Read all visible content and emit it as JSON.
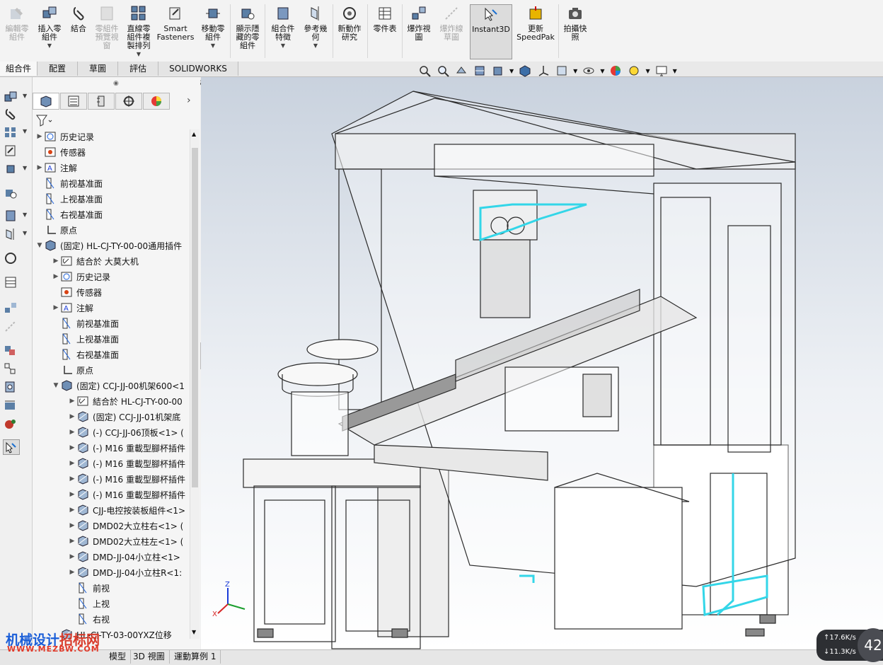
{
  "ribbon": {
    "buttons": [
      {
        "label": "編輯零\n組件",
        "icon": "edit-component-icon",
        "disabled": true
      },
      {
        "label": "插入零\n組件",
        "icon": "insert-component-icon",
        "caret": true
      },
      {
        "label": "結合",
        "icon": "mate-icon"
      },
      {
        "label": "零組件\n預覽視\n窗",
        "icon": "component-preview-icon",
        "disabled": true
      },
      {
        "label": "直線零\n組件複\n製排列",
        "icon": "linear-pattern-icon",
        "caret": true
      },
      {
        "label": "Smart\nFasteners",
        "icon": "smart-fasteners-icon"
      },
      {
        "label": "移動零\n組件",
        "icon": "move-component-icon",
        "caret": true
      },
      {
        "label": "顯示隱\n藏的零\n組件",
        "icon": "show-hidden-icon"
      },
      {
        "label": "組合件\n特徵",
        "icon": "assembly-features-icon",
        "caret": true
      },
      {
        "label": "參考幾\n何",
        "icon": "reference-geometry-icon",
        "caret": true
      },
      {
        "label": "新動作\n研究",
        "icon": "motion-study-icon"
      },
      {
        "label": "零件表",
        "icon": "bom-icon"
      },
      {
        "label": "爆炸視\n圖",
        "icon": "exploded-view-icon"
      },
      {
        "label": "爆炸線\n草圖",
        "icon": "explode-line-icon",
        "disabled": true
      },
      {
        "label": "Instant3D",
        "icon": "instant3d-icon",
        "active": true
      },
      {
        "label": "更新\nSpeedPak",
        "icon": "speedpak-icon"
      },
      {
        "label": "拍攝快\n照",
        "icon": "snapshot-icon"
      }
    ]
  },
  "command_tabs": [
    "組合件",
    "配置",
    "草圖",
    "評估",
    "SOLIDWORKS MBD"
  ],
  "feature_tree": {
    "rows": [
      {
        "level": 0,
        "exp": "▶",
        "icon": "history",
        "label": "历史记录"
      },
      {
        "level": 0,
        "exp": "",
        "icon": "sensor",
        "label": "传感器"
      },
      {
        "level": 0,
        "exp": "▶",
        "icon": "annotation",
        "label": "注解"
      },
      {
        "level": 0,
        "exp": "",
        "icon": "plane",
        "label": "前视基准面"
      },
      {
        "level": 0,
        "exp": "",
        "icon": "plane",
        "label": "上视基准面"
      },
      {
        "level": 0,
        "exp": "",
        "icon": "plane",
        "label": "右视基准面"
      },
      {
        "level": 0,
        "exp": "",
        "icon": "origin",
        "label": "原点"
      },
      {
        "level": 0,
        "exp": "▼",
        "icon": "assembly",
        "label": "(固定) HL-CJ-TY-00-00通用插件"
      },
      {
        "level": 1,
        "exp": "▶",
        "icon": "mates",
        "label": "結合於 大莫大机"
      },
      {
        "level": 1,
        "exp": "▶",
        "icon": "history",
        "label": "历史记录"
      },
      {
        "level": 1,
        "exp": "",
        "icon": "sensor",
        "label": "传感器"
      },
      {
        "level": 1,
        "exp": "▶",
        "icon": "annotation",
        "label": "注解"
      },
      {
        "level": 1,
        "exp": "",
        "icon": "plane",
        "label": "前视基准面"
      },
      {
        "level": 1,
        "exp": "",
        "icon": "plane",
        "label": "上视基准面"
      },
      {
        "level": 1,
        "exp": "",
        "icon": "plane",
        "label": "右视基准面"
      },
      {
        "level": 1,
        "exp": "",
        "icon": "origin",
        "label": "原点"
      },
      {
        "level": 1,
        "exp": "▼",
        "icon": "assembly",
        "label": "(固定) CCJ-JJ-00机架600<1"
      },
      {
        "level": 2,
        "exp": "▶",
        "icon": "mates",
        "label": "結合於 HL-CJ-TY-00-00"
      },
      {
        "level": 2,
        "exp": "▶",
        "icon": "subasm",
        "label": "(固定) CCJ-JJ-01机架底"
      },
      {
        "level": 2,
        "exp": "▶",
        "icon": "subasm",
        "label": "(-) CCJ-JJ-06顶板<1> ("
      },
      {
        "level": 2,
        "exp": "▶",
        "icon": "subasm",
        "label": "(-) M16 重載型腳杯插件"
      },
      {
        "level": 2,
        "exp": "▶",
        "icon": "subasm",
        "label": "(-) M16 重載型腳杯插件"
      },
      {
        "level": 2,
        "exp": "▶",
        "icon": "subasm",
        "label": "(-) M16 重載型腳杯插件"
      },
      {
        "level": 2,
        "exp": "▶",
        "icon": "subasm",
        "label": "(-) M16 重載型腳杯插件"
      },
      {
        "level": 2,
        "exp": "▶",
        "icon": "subasm",
        "label": "CJJ-电控按装板組件<1>"
      },
      {
        "level": 2,
        "exp": "▶",
        "icon": "subasm",
        "label": "DMD02大立柱右<1> ("
      },
      {
        "level": 2,
        "exp": "▶",
        "icon": "subasm",
        "label": "DMD02大立柱左<1> ("
      },
      {
        "level": 2,
        "exp": "▶",
        "icon": "subasm",
        "label": "DMD-JJ-04小立柱<1>"
      },
      {
        "level": 2,
        "exp": "▶",
        "icon": "subasm",
        "label": "DMD-JJ-04小立柱R<1:"
      },
      {
        "level": 2,
        "exp": "",
        "icon": "plane",
        "label": "前视"
      },
      {
        "level": 2,
        "exp": "",
        "icon": "plane",
        "label": "上视"
      },
      {
        "level": 2,
        "exp": "",
        "icon": "plane",
        "label": "右视"
      },
      {
        "level": 1,
        "exp": "",
        "icon": "subasm",
        "label": "HL-CJ-TY-03-00YXZ位移"
      }
    ]
  },
  "bottom_tabs": [
    "模型",
    "3D 視圖",
    "運動算例 1"
  ],
  "watermark": {
    "line1_blue": "机械设计",
    "line1_red": "招标网",
    "line2": "WWW.MEZBW.COM"
  },
  "network": {
    "up": "↑17.6K/s",
    "down": "↓11.3K/s",
    "badge": "42"
  },
  "colors": {
    "highlight": "#33d6e8",
    "accent": "#1a5ed8"
  }
}
